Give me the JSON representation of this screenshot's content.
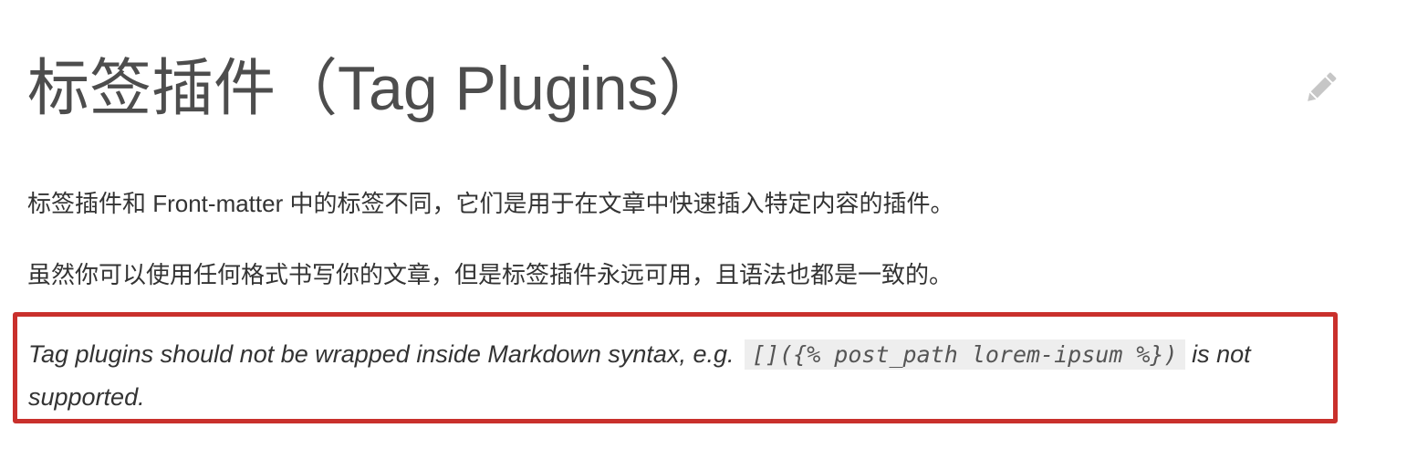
{
  "header": {
    "title": "标签插件（Tag Plugins）",
    "edit_icon": "pencil-icon"
  },
  "content": {
    "paragraph_1": "标签插件和 Front-matter 中的标签不同，它们是用于在文章中快速插入特定内容的插件。",
    "paragraph_2": "虽然你可以使用任何格式书写你的文章，但是标签插件永远可用，且语法也都是一致的。"
  },
  "note": {
    "text_before": "Tag plugins should not be wrapped inside Markdown syntax, e.g. ",
    "code": "[]({% post_path lorem-ipsum %})",
    "text_after": " is not supported.",
    "border_color": "#c9302c"
  }
}
